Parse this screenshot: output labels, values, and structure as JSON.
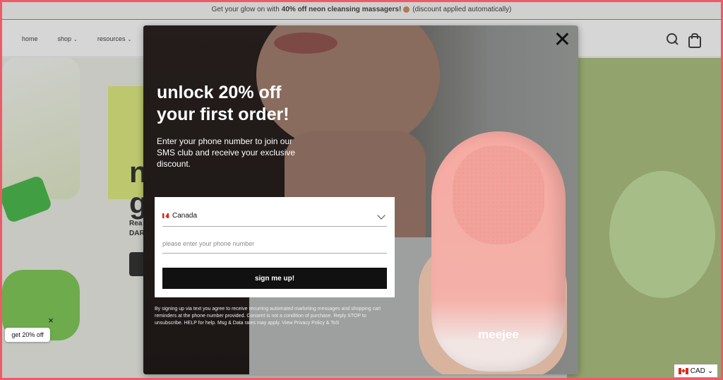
{
  "announcement": {
    "prefix": "Get your glow on with",
    "bold": "40% off neon cleansing massagers!",
    "suffix": "(discount applied automatically)"
  },
  "nav": {
    "items": [
      {
        "label": "home",
        "has_dropdown": false
      },
      {
        "label": "shop",
        "has_dropdown": true
      },
      {
        "label": "resources",
        "has_dropdown": true
      }
    ],
    "chevron": "⌄"
  },
  "header_icons": [
    "search-icon",
    "cart-icon"
  ],
  "hero": {
    "heading_line1": "n",
    "heading_line2": "g",
    "sub_line1": "Rea",
    "sub_line2": "DAR"
  },
  "popup": {
    "headline_line1": "unlock 20% off",
    "headline_line2": "your first order!",
    "subtext": "Enter your phone number to join our SMS club and receive your exclusive discount.",
    "country": "Canada",
    "phone_placeholder": "please enter your phone number",
    "submit_label": "sign me up!",
    "legal": "By signing up via text you agree to receive recurring automated marketing messages and shopping cart reminders at the phone number provided. Consent is not a condition of purchase. Reply STOP to unsubscribe. HELP for help. Msg & Data rates may apply. View Privacy Policy & ToS",
    "product_brand": "meejee"
  },
  "teaser": {
    "label": "get 20% off",
    "close": "×"
  },
  "currency": {
    "label": "CAD",
    "chevron": "⌄"
  },
  "colors": {
    "border": "#ef5a68",
    "button": "#111111",
    "overlay": "#7a7a7a"
  }
}
